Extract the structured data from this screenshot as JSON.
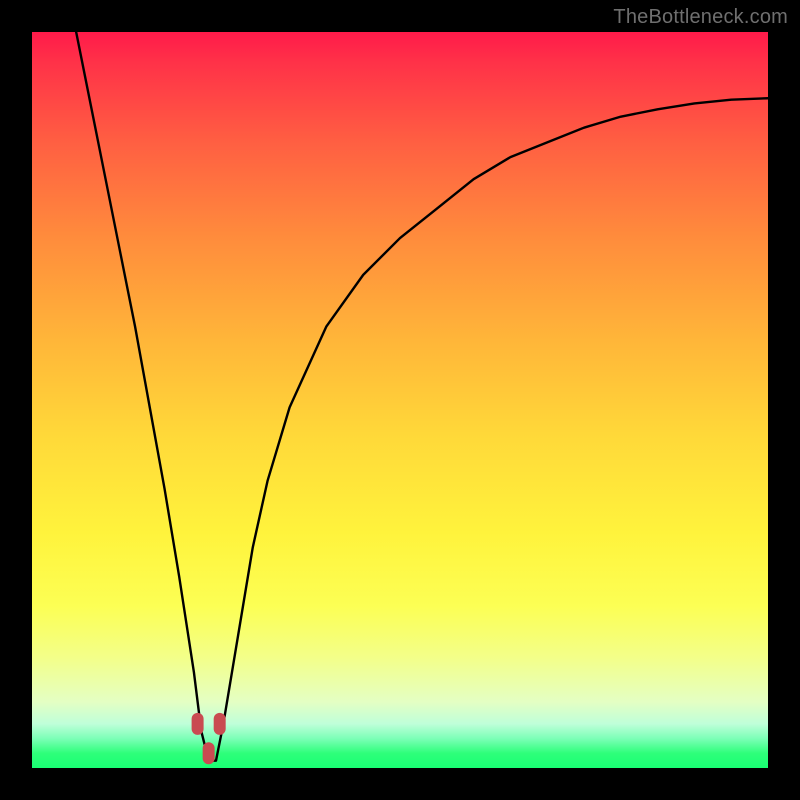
{
  "watermark": "TheBottleneck.com",
  "colors": {
    "frame": "#000000",
    "curve": "#000000",
    "marker": "#c94b51",
    "watermark": "#6f6f6f",
    "gradient_top": "#ff1a4a",
    "gradient_bottom": "#19ff73"
  },
  "chart_data": {
    "type": "line",
    "title": "",
    "xlabel": "",
    "ylabel": "",
    "xlim": [
      0,
      100
    ],
    "ylim": [
      0,
      100
    ],
    "grid": false,
    "legend": false,
    "annotations": [],
    "notes": "No numeric axes or tick labels are shown. Values below are the curve's y(x) read from pixel positions within the plot area, normalized to [0,100] on both axes (0,0 = bottom-left). Red markers at the dip.",
    "series": [
      {
        "name": "curve",
        "x": [
          6,
          8,
          10,
          12,
          14,
          16,
          18,
          20,
          22,
          23,
          24,
          25,
          26,
          28,
          30,
          32,
          35,
          40,
          45,
          50,
          55,
          60,
          65,
          70,
          75,
          80,
          85,
          90,
          95,
          100
        ],
        "values": [
          100,
          90,
          80,
          70,
          60,
          49,
          38,
          26,
          13,
          5,
          1,
          1,
          6,
          18,
          30,
          39,
          49,
          60,
          67,
          72,
          76,
          80,
          83,
          85,
          87,
          88.5,
          89.5,
          90.3,
          90.8,
          91
        ]
      }
    ],
    "markers": [
      {
        "x": 22.5,
        "y": 6,
        "shape": "rounded-pill",
        "color": "#c94b51"
      },
      {
        "x": 25.5,
        "y": 6,
        "shape": "rounded-pill",
        "color": "#c94b51"
      },
      {
        "x": 24.0,
        "y": 2,
        "shape": "rounded-pill",
        "color": "#c94b51"
      }
    ]
  }
}
